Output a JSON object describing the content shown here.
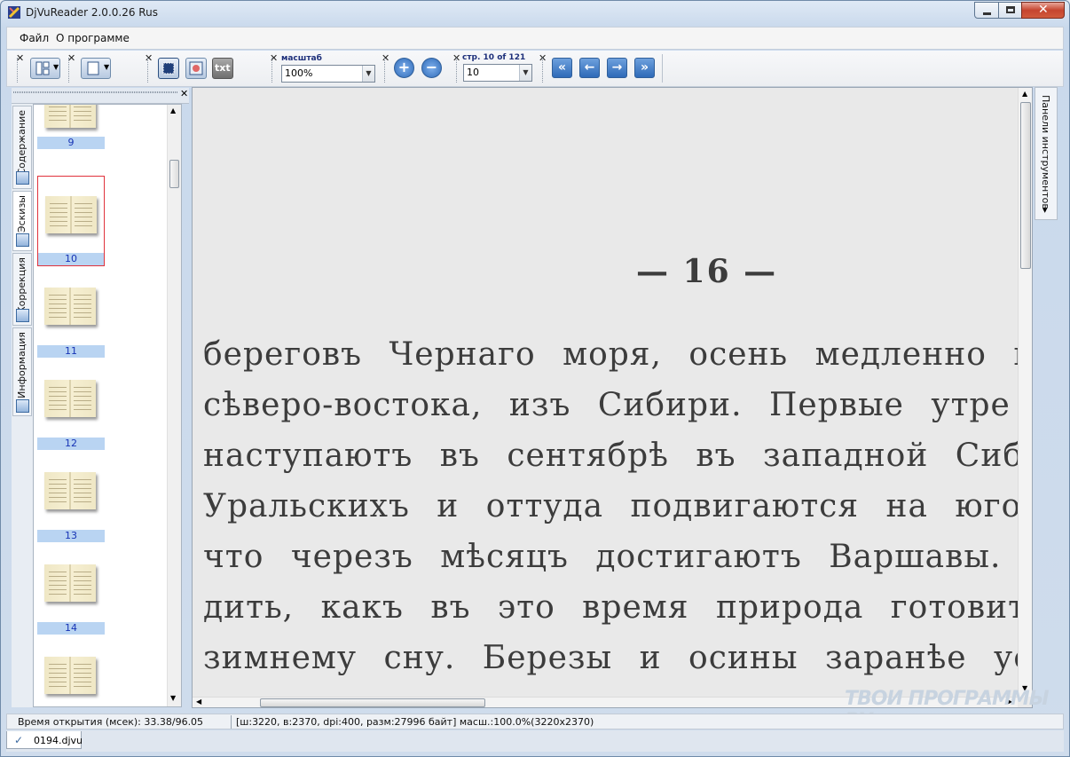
{
  "window": {
    "title": "DjVuReader 2.0.0.26 Rus"
  },
  "menu": {
    "items": [
      "Файл",
      "О программе"
    ]
  },
  "toolbar": {
    "zoom_label": "масштаб",
    "zoom_value": "100%",
    "page_label": "стр. 10 of 121",
    "page_value": "10",
    "text_button": "txt"
  },
  "sidebar": {
    "tabs": [
      "Содержание",
      "Эскизы",
      "Коррекция",
      "Информация"
    ],
    "thumbnails": [
      "9",
      "10",
      "11",
      "12",
      "13",
      "14"
    ],
    "selected_page": "10"
  },
  "document": {
    "page_number": "— 16 —",
    "lines": [
      "береговъ Чернаго моря, осень медленно п",
      "сѣверо-востока, изъ Сибири. Первые утре",
      "наступаютъ въ сентябрѣ въ западной Сибири",
      "Уральскихъ и оттуда подвигаются на юго-з",
      "что черезъ мѣсяцъ достигаютъ Варшавы. Любо",
      "дить, какъ въ это время природа готовится",
      "зимнему сну. Березы и осины заранѣе усыпал"
    ]
  },
  "right_panel": {
    "label": "Панели инструментов"
  },
  "status": {
    "open_time": "Время открытия (мсек): 33.38/96.05",
    "info": "[ш:3220, в:2370, dpi:400, разм:27996 байт] масш.:100.0%(3220x2370)"
  },
  "file_tab": {
    "name": "0194.djvu"
  },
  "watermark": "ТВОИ ПРОГРАММЫ РУ"
}
